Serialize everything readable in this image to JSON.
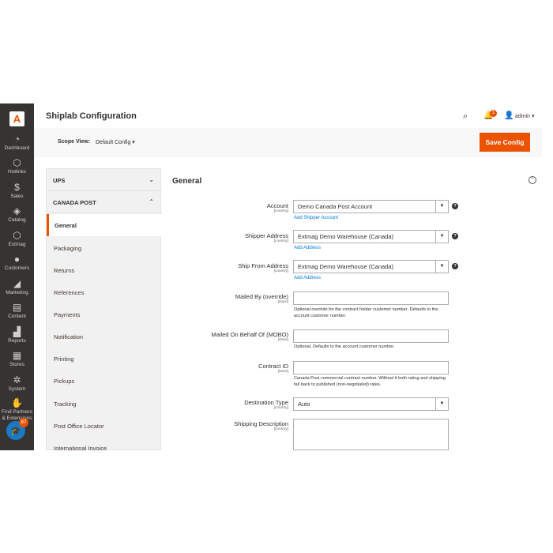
{
  "sidebar": {
    "logo": "A",
    "items": [
      {
        "icon": "dashboard-icon",
        "glyph": "◔",
        "label": "Dashboard"
      },
      {
        "icon": "hotlinks-icon",
        "glyph": "⬡",
        "label": "Hotlinks"
      },
      {
        "icon": "sales-icon",
        "glyph": "$",
        "label": "Sales"
      },
      {
        "icon": "catalog-icon",
        "glyph": "◈",
        "label": "Catalog"
      },
      {
        "icon": "extmag-icon",
        "glyph": "⬡",
        "label": "Extmag"
      },
      {
        "icon": "customers-icon",
        "glyph": "●",
        "label": "Customers"
      },
      {
        "icon": "marketing-icon",
        "glyph": "◢",
        "label": "Marketing"
      },
      {
        "icon": "content-icon",
        "glyph": "▤",
        "label": "Content"
      },
      {
        "icon": "reports-icon",
        "glyph": "▟",
        "label": "Reports"
      },
      {
        "icon": "stores-icon",
        "glyph": "▦",
        "label": "Stores"
      },
      {
        "icon": "system-icon",
        "glyph": "✲",
        "label": "System"
      },
      {
        "icon": "find-partners-icon",
        "glyph": "✋",
        "label": "Find Partners & Extensions"
      }
    ],
    "notification_count": "87"
  },
  "header": {
    "title": "Shiplab Configuration",
    "bell_count": "1",
    "user": "admin ▾"
  },
  "toolbar": {
    "scope_label": "Scope View:",
    "scope_value": "Default Config ▾",
    "save_label": "Save Config"
  },
  "tabs": {
    "groups": [
      {
        "label": "UPS",
        "chevron": "⌄"
      },
      {
        "label": "CANADA POST",
        "chevron": "⌃"
      }
    ],
    "items": [
      "General",
      "Packaging",
      "Returns",
      "References",
      "Payments",
      "Notification",
      "Printing",
      "Pickups",
      "Tracking",
      "Post Office Locator",
      "International Invoice"
    ]
  },
  "main": {
    "section_title": "General",
    "collapse": "⌃",
    "fields": {
      "account": {
        "label": "Account",
        "scope": "[country]",
        "value": "Demo Canada Post Account",
        "link": "Add Shipper Account"
      },
      "shipper_address": {
        "label": "Shipper Address",
        "scope": "[country]",
        "value": "Extmag Demo Warehouse (Canada)",
        "link": "Add Address"
      },
      "ship_from": {
        "label": "Ship From Address",
        "scope": "[country]",
        "value": "Extmag Demo Warehouse (Canada)",
        "link": "Add Address"
      },
      "mailed_by": {
        "label": "Mailed By (override)",
        "scope": "[store]",
        "note": "Optional override for the contract holder customer number. Defaults to the account customer number."
      },
      "mobo": {
        "label": "Mailed On Behalf Of (MOBO)",
        "scope": "[store]",
        "note": "Optional. Defaults to the account customer number."
      },
      "contract": {
        "label": "Contract ID",
        "scope": "[store]",
        "note": "Canada Post commercial contract number. Without it both rating and shipping fall back to published (non-negotiated) rates."
      },
      "destination": {
        "label": "Destination Type",
        "scope": "[country]",
        "value": "Auto"
      },
      "shipping_desc": {
        "label": "Shipping Description",
        "scope": "[country]"
      }
    }
  }
}
